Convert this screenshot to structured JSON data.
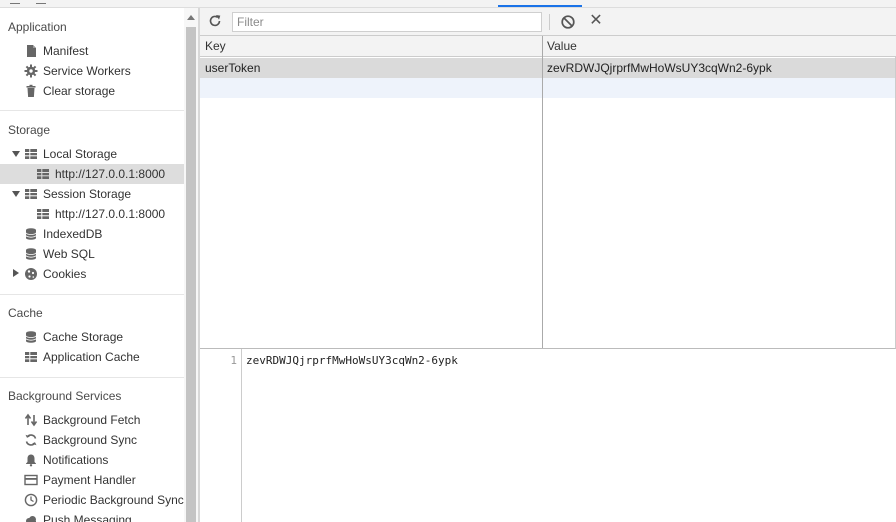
{
  "sidebar": {
    "sections": [
      {
        "title": "Application",
        "items": [
          {
            "label": "Manifest",
            "icon": "document-icon"
          },
          {
            "label": "Service Workers",
            "icon": "gear-icon"
          },
          {
            "label": "Clear storage",
            "icon": "trash-icon"
          }
        ]
      },
      {
        "title": "Storage",
        "items": [
          {
            "label": "Local Storage",
            "icon": "table-icon",
            "expanded": true
          },
          {
            "label": "http://127.0.0.1:8000",
            "icon": "table-icon",
            "selected": true
          },
          {
            "label": "Session Storage",
            "icon": "table-icon",
            "expanded": true
          },
          {
            "label": "http://127.0.0.1:8000",
            "icon": "table-icon"
          },
          {
            "label": "IndexedDB",
            "icon": "database-icon"
          },
          {
            "label": "Web SQL",
            "icon": "database-icon"
          },
          {
            "label": "Cookies",
            "icon": "cookie-icon",
            "expanded": false
          }
        ]
      },
      {
        "title": "Cache",
        "items": [
          {
            "label": "Cache Storage",
            "icon": "database-icon"
          },
          {
            "label": "Application Cache",
            "icon": "table-icon"
          }
        ]
      },
      {
        "title": "Background Services",
        "items": [
          {
            "label": "Background Fetch",
            "icon": "up-down-arrows-icon"
          },
          {
            "label": "Background Sync",
            "icon": "sync-icon"
          },
          {
            "label": "Notifications",
            "icon": "bell-icon"
          },
          {
            "label": "Payment Handler",
            "icon": "card-icon"
          },
          {
            "label": "Periodic Background Sync",
            "icon": "clock-icon"
          },
          {
            "label": "Push Messaging",
            "icon": "cloud-icon"
          }
        ]
      }
    ]
  },
  "toolbar": {
    "filter_placeholder": "Filter",
    "refresh_icon": "refresh-icon",
    "block_icon": "block-icon",
    "clear_icon": "close-icon"
  },
  "table": {
    "columns": [
      "Key",
      "Value"
    ],
    "rows": [
      {
        "key": "userToken",
        "value": "zevRDWJQjrprfMwHoWsUY3cqWn2-6ypk"
      }
    ]
  },
  "preview": {
    "line_number": "1",
    "content": "zevRDWJQjrprfMwHoWsUY3cqWn2-6ypk"
  },
  "colors": {
    "selected_row": "#dadada",
    "selected_sidebar": "#dddddd",
    "tab_indicator": "#1a73e8"
  }
}
